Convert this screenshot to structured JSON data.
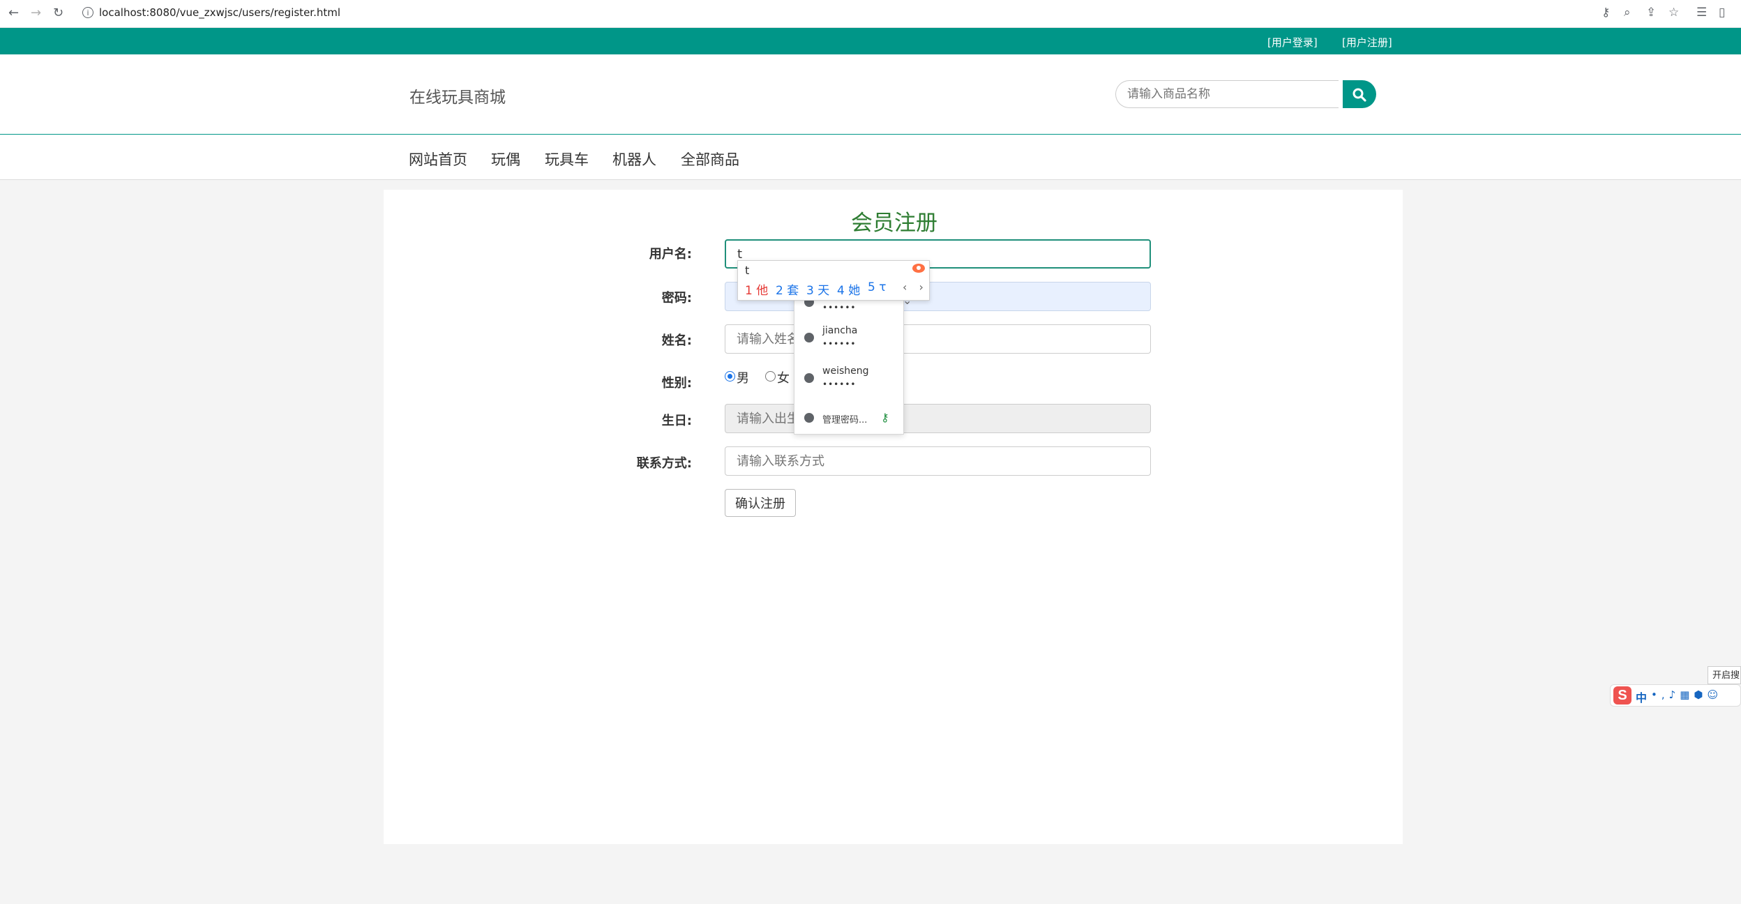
{
  "browser": {
    "url": "localhost:8080/vue_zxwjsc/users/register.html",
    "back_icon": "←",
    "forward_icon": "→",
    "reload_icon": "↻",
    "info_icon": "i"
  },
  "topbar": {
    "login": "[用户登录]",
    "register": "[用户注册]"
  },
  "header": {
    "logo": "在线玩具商城",
    "search_placeholder": "请输入商品名称"
  },
  "nav": {
    "items": [
      "网站首页",
      "玩偶",
      "玩具车",
      "机器人",
      "全部商品"
    ]
  },
  "form": {
    "title": "会员注册",
    "username_label": "用户名:",
    "username_value": "t",
    "password_label": "密码:",
    "name_label": "姓名:",
    "name_placeholder": "请输入姓名",
    "gender_label": "性别:",
    "gender_male": "男",
    "gender_female": "女",
    "birthday_label": "生日:",
    "birthday_placeholder": "请输入出生日期",
    "contact_label": "联系方式:",
    "contact_placeholder": "请输入联系方式",
    "submit": "确认注册"
  },
  "ime": {
    "composition": "t",
    "candidates": [
      "1 他",
      "2 套",
      "3 天",
      "4 她",
      "5 τ"
    ],
    "arrows": "‹ › ⌄"
  },
  "password_dropdown": {
    "accounts": [
      {
        "user": "",
        "dots": "••••••"
      },
      {
        "user": "jiancha",
        "dots": "••••••"
      },
      {
        "user": "weisheng",
        "dots": "••••••"
      }
    ],
    "manage": "管理密码...",
    "key_icon": "⚷"
  },
  "sogou": {
    "logo": "S",
    "lang": "中",
    "tip": "开启搜"
  }
}
